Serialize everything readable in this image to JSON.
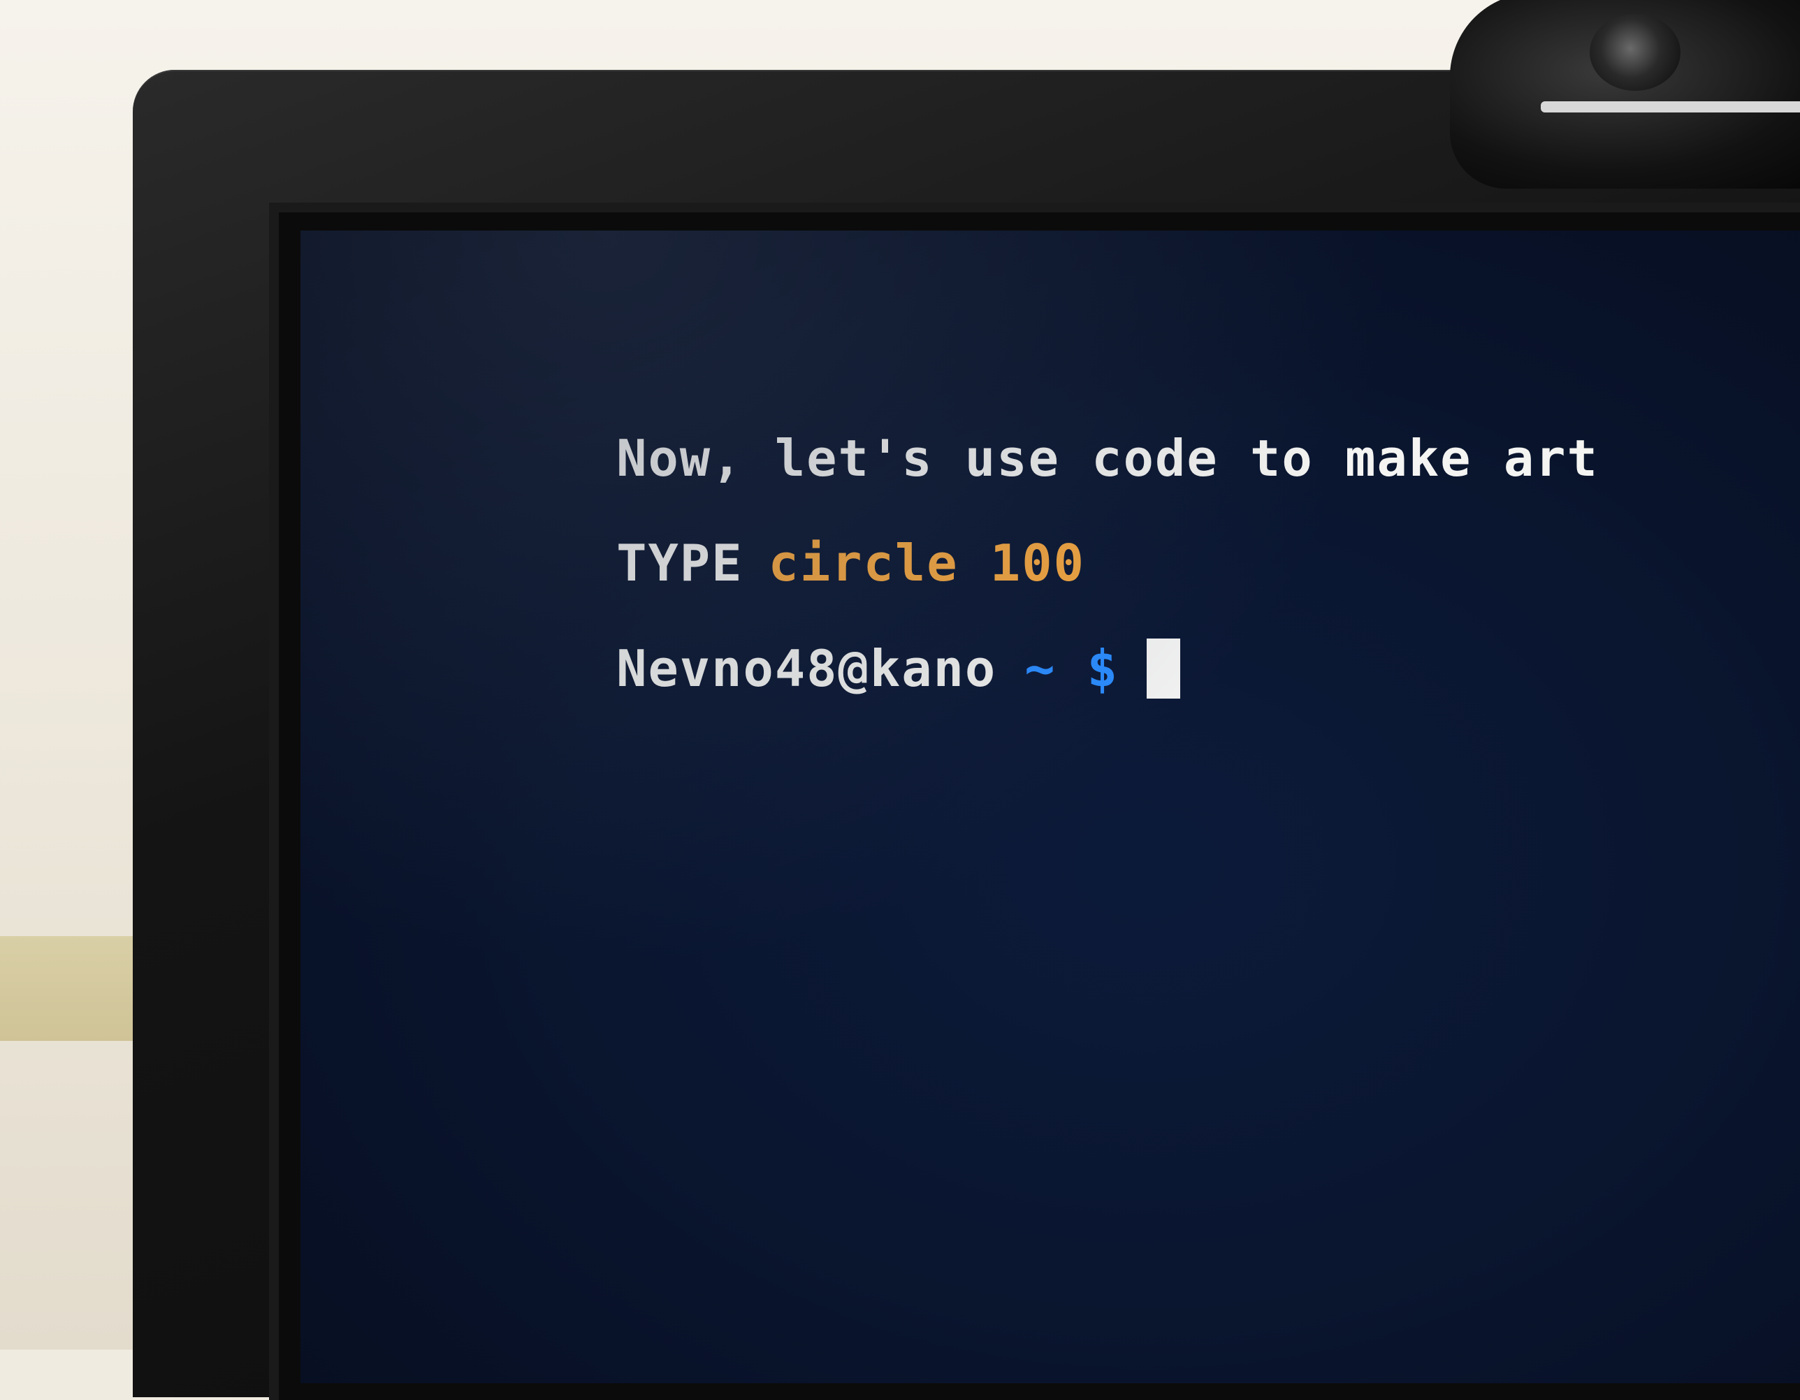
{
  "terminal": {
    "message": "Now, let's use code to make art",
    "instruction_keyword": "TYPE",
    "instruction_command": "circle 100",
    "prompt_user": "Nevno48@kano",
    "prompt_dir": "~",
    "prompt_symbol": "$"
  },
  "colors": {
    "background": "#0a1630",
    "text": "#f4f4f2",
    "command": "#f4a640",
    "prompt_accent": "#2a8cff"
  }
}
